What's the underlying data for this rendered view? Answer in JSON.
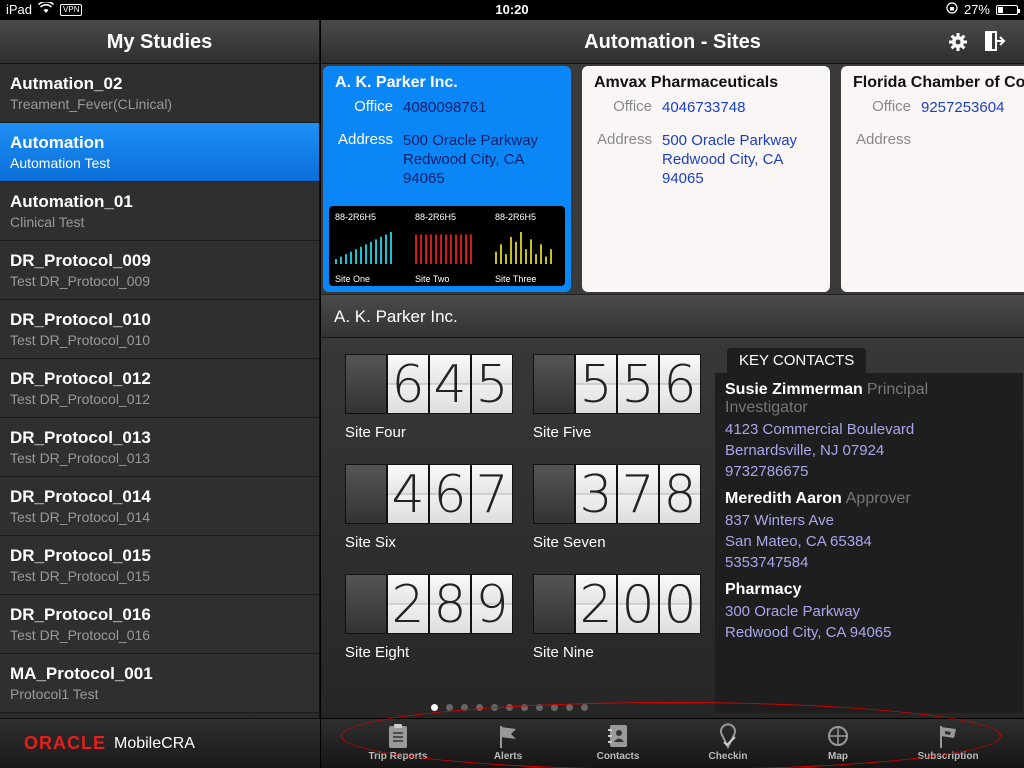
{
  "status_bar": {
    "device": "iPad",
    "vpn": "VPN",
    "time": "10:20",
    "battery": "27%",
    "battery_level": 0.27
  },
  "left": {
    "title": "My Studies",
    "studies": [
      {
        "title": "Autmation_02",
        "subtitle": "Treament_Fever(CLinical)"
      },
      {
        "title": "Automation",
        "subtitle": "Automation Test"
      },
      {
        "title": "Automation_01",
        "subtitle": "Clinical Test"
      },
      {
        "title": "DR_Protocol_009",
        "subtitle": "Test DR_Protocol_009"
      },
      {
        "title": "DR_Protocol_010",
        "subtitle": "Test DR_Protocol_010"
      },
      {
        "title": "DR_Protocol_012",
        "subtitle": "Test DR_Protocol_012"
      },
      {
        "title": "DR_Protocol_013",
        "subtitle": "Test DR_Protocol_013"
      },
      {
        "title": "DR_Protocol_014",
        "subtitle": "Test DR_Protocol_014"
      },
      {
        "title": "DR_Protocol_015",
        "subtitle": "Test DR_Protocol_015"
      },
      {
        "title": "DR_Protocol_016",
        "subtitle": "Test DR_Protocol_016"
      },
      {
        "title": "MA_Protocol_001",
        "subtitle": "Protocol1 Test"
      }
    ],
    "selected_index": 1,
    "footer": {
      "brand": "ORACLE",
      "product": "MobileCRA"
    }
  },
  "header": {
    "title": "Automation - Sites",
    "icons": [
      "gear-icon",
      "logout-icon"
    ]
  },
  "sites": [
    {
      "name": "A. K. Parker Inc.",
      "office_label": "Office",
      "office": "4080098761",
      "address_label": "Address",
      "address": [
        "500 Oracle Parkway",
        "Redwood City, CA",
        "94065"
      ],
      "minis": [
        {
          "code": "88-2R6H5",
          "name": "Site One",
          "color": "#19c3d6",
          "values": [
            2,
            3,
            4,
            5,
            6,
            7,
            8,
            9,
            10,
            11,
            12,
            13
          ]
        },
        {
          "code": "88-2R6H5",
          "name": "Site Two",
          "color": "#d11a1a",
          "values": [
            12,
            12,
            12,
            12,
            12,
            12,
            12,
            12,
            12,
            12,
            12,
            12
          ]
        },
        {
          "code": "88-2R6H5",
          "name": "Site Three",
          "color": "#c9c214",
          "values": [
            5,
            8,
            4,
            11,
            9,
            13,
            6,
            10,
            4,
            8,
            3,
            6
          ]
        }
      ]
    },
    {
      "name": "Amvax Pharmaceuticals",
      "office_label": "Office",
      "office": "4046733748",
      "address_label": "Address",
      "address": [
        "500 Oracle Parkway",
        "Redwood City, CA",
        "94065"
      ]
    },
    {
      "name": "Florida Chamber of Com",
      "office_label": "Office",
      "office": "9257253604",
      "address_label": "Address",
      "address": []
    }
  ],
  "detail": {
    "title": "A. K. Parker Inc.",
    "counters": [
      {
        "digits": "645",
        "label": "Site Four"
      },
      {
        "digits": "556",
        "label": "Site Five"
      },
      {
        "digits": "467",
        "label": "Site Six"
      },
      {
        "digits": "378",
        "label": "Site Seven"
      },
      {
        "digits": "289",
        "label": "Site Eight"
      },
      {
        "digits": "200",
        "label": "Site Nine"
      }
    ],
    "contacts_title": "KEY CONTACTS",
    "contacts": [
      {
        "name": "Susie Zimmerman",
        "role": "Principal Investigator",
        "lines": [
          "4123 Commercial Boulevard",
          "Bernardsville, NJ 07924",
          "9732786675"
        ]
      },
      {
        "name": "Meredith Aaron",
        "role": "Approver",
        "lines": [
          "837 Winters Ave",
          "San Mateo, CA 65384",
          "5353747584"
        ]
      },
      {
        "name": "Pharmacy",
        "role": "",
        "lines": [
          "300 Oracle Parkway",
          "Redwood City, CA 94065"
        ]
      }
    ],
    "page_dots": 11,
    "page_active": 0
  },
  "tabs": [
    {
      "label": "Trip Reports",
      "icon": "clipboard-icon"
    },
    {
      "label": "Alerts",
      "icon": "flag-icon"
    },
    {
      "label": "Contacts",
      "icon": "address-book-icon"
    },
    {
      "label": "Checkin",
      "icon": "map-pin-check-icon"
    },
    {
      "label": "Map",
      "icon": "crosshair-icon"
    },
    {
      "label": "Subscription",
      "icon": "flag-sign-icon"
    }
  ],
  "colors": {
    "selection_blue": "#0a86f6",
    "link_blue": "#1b3fc4",
    "contact_text": "#a9a7ec",
    "oracle_red": "#e3201b",
    "annotation_red": "#dd0000"
  }
}
